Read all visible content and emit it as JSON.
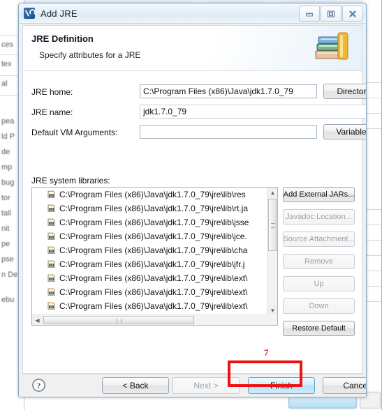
{
  "window": {
    "title": "Add JRE",
    "icon": "jre-wrench-icon",
    "controls": {
      "minimize": "minimize-icon",
      "maximize": "maximize-icon",
      "close": "close-icon"
    }
  },
  "header": {
    "title": "JRE Definition",
    "subtitle": "Specify attributes for a JRE",
    "icon": "books-icon"
  },
  "form": {
    "jre_home": {
      "label": "JRE home:",
      "value": "C:\\Program Files (x86)\\Java\\jdk1.7.0_79",
      "button": "Directory..."
    },
    "jre_name": {
      "label": "JRE name:",
      "value": "jdk1.7.0_79"
    },
    "vm_args": {
      "label": "Default VM Arguments:",
      "value": "",
      "button": "Variables..."
    }
  },
  "libraries": {
    "label": "JRE system libraries:",
    "items": [
      {
        "icon": "jar-icon",
        "text": "C:\\Program Files (x86)\\Java\\jdk1.7.0_79\\jre\\lib\\res"
      },
      {
        "icon": "jar-icon",
        "text": "C:\\Program Files (x86)\\Java\\jdk1.7.0_79\\jre\\lib\\rt.ja"
      },
      {
        "icon": "jar-icon",
        "text": "C:\\Program Files (x86)\\Java\\jdk1.7.0_79\\jre\\lib\\jsse"
      },
      {
        "icon": "jar-icon",
        "text": "C:\\Program Files (x86)\\Java\\jdk1.7.0_79\\jre\\lib\\jce."
      },
      {
        "icon": "jar-icon",
        "text": "C:\\Program Files (x86)\\Java\\jdk1.7.0_79\\jre\\lib\\cha"
      },
      {
        "icon": "jar-icon",
        "text": "C:\\Program Files (x86)\\Java\\jdk1.7.0_79\\jre\\lib\\jfr.j"
      },
      {
        "icon": "jar-icon",
        "text": "C:\\Program Files (x86)\\Java\\jdk1.7.0_79\\jre\\lib\\ext\\"
      },
      {
        "icon": "jar-icon",
        "text": "C:\\Program Files (x86)\\Java\\jdk1.7.0_79\\jre\\lib\\ext\\"
      },
      {
        "icon": "jar-icon",
        "text": "C:\\Program Files (x86)\\Java\\jdk1.7.0_79\\jre\\lib\\ext\\"
      },
      {
        "icon": "jar-icon",
        "text": "C:\\Program Files (x86)\\Java\\jdk1.7.0_79\\jre\\lib\\ext\\"
      }
    ],
    "side_buttons": [
      {
        "label": "Add External JARs...",
        "enabled": true
      },
      {
        "label": "Javadoc Location...",
        "enabled": false
      },
      {
        "label": "Source Attachment...",
        "enabled": false
      },
      {
        "label": "Remove",
        "enabled": false
      },
      {
        "label": "Up",
        "enabled": false
      },
      {
        "label": "Down",
        "enabled": false
      },
      {
        "label": "Restore Default",
        "enabled": true
      }
    ]
  },
  "footer": {
    "help_icon": "help-icon",
    "back": "< Back",
    "next": "Next >",
    "finish": "Finish",
    "cancel": "Cancel"
  },
  "annotation": {
    "number": "7",
    "color": "#ee1111",
    "target": "Finish"
  },
  "background": {
    "left_labels": [
      "ces",
      "tex",
      "al",
      "pea",
      "ld P",
      "de",
      "mp",
      "bug",
      "tor",
      "tall",
      "nit",
      "pe",
      "pse",
      "n De",
      "ebu"
    ]
  }
}
